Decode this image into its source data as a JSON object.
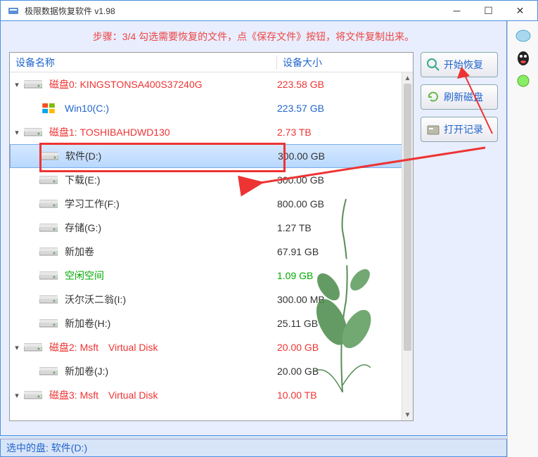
{
  "titlebar": {
    "title": "极限数据恢复软件 v1.98"
  },
  "instruction": "步骤：3/4 勾选需要恢复的文件，点《保存文件》按钮，将文件复制出来。",
  "headers": {
    "name": "设备名称",
    "size": "设备大小"
  },
  "rows": [
    {
      "indent": 1,
      "expand": "▾",
      "label": "磁盘0: KINGSTONSA400S37240G",
      "size": "223.58 GB",
      "color": "red"
    },
    {
      "indent": 2,
      "expand": "",
      "label": "Win10(C:)",
      "size": "223.57 GB",
      "color": "blue",
      "winicon": true
    },
    {
      "indent": 1,
      "expand": "▾",
      "label": "磁盘1: TOSHIBAHDWD130",
      "size": "2.73 TB",
      "color": "red"
    },
    {
      "indent": 2,
      "expand": "",
      "label": "软件(D:)",
      "size": "300.00 GB",
      "color": "black",
      "selected": true
    },
    {
      "indent": 2,
      "expand": "",
      "label": "下载(E:)",
      "size": "300.00 GB",
      "color": "black"
    },
    {
      "indent": 2,
      "expand": "",
      "label": "学习工作(F:)",
      "size": "800.00 GB",
      "color": "black"
    },
    {
      "indent": 2,
      "expand": "",
      "label": "存储(G:)",
      "size": "1.27 TB",
      "color": "black"
    },
    {
      "indent": 2,
      "expand": "",
      "label": "新加卷",
      "size": "67.91 GB",
      "color": "black"
    },
    {
      "indent": 2,
      "expand": "",
      "label": "空闲空间",
      "size": "1.09 GB",
      "color": "green"
    },
    {
      "indent": 2,
      "expand": "",
      "label": "沃尔沃二翁(I:)",
      "size": "300.00 MB",
      "color": "black"
    },
    {
      "indent": 2,
      "expand": "",
      "label": "新加卷(H:)",
      "size": "25.11 GB",
      "color": "black"
    },
    {
      "indent": 1,
      "expand": "▾",
      "label": "磁盘2: Msft　Virtual Disk",
      "size": "20.00 GB",
      "color": "red"
    },
    {
      "indent": 2,
      "expand": "",
      "label": "新加卷(J:)",
      "size": "20.00 GB",
      "color": "black"
    },
    {
      "indent": 1,
      "expand": "▾",
      "label": "磁盘3: Msft　Virtual Disk",
      "size": "10.00 TB",
      "color": "red"
    }
  ],
  "buttons": {
    "start": "开始恢复",
    "refresh": "刷新磁盘",
    "openlog": "打开记录"
  },
  "statusbar": "选中的盘: 软件(D:)"
}
